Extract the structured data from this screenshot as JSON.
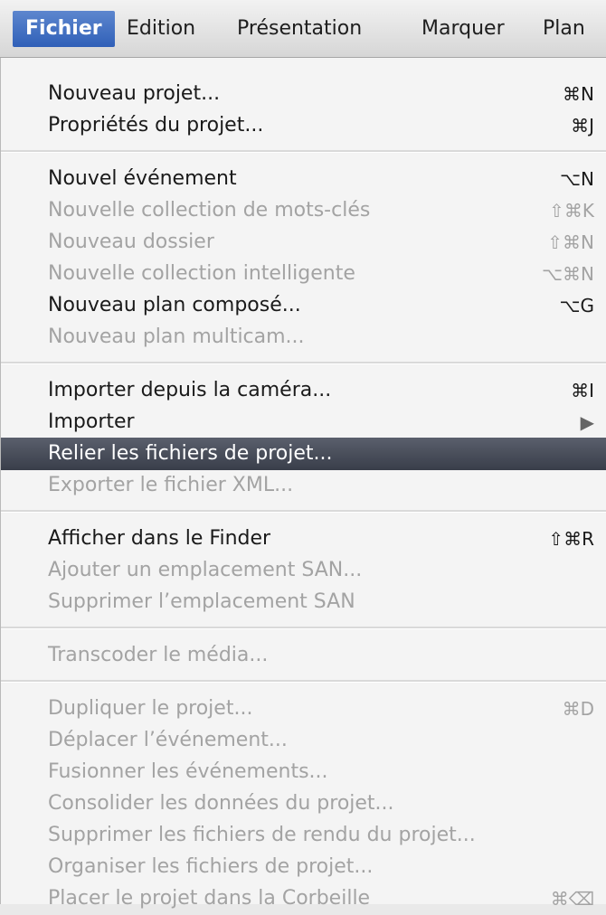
{
  "menubar": {
    "items": [
      "Fichier",
      "Edition",
      "Présentation",
      "Marquer",
      "Plan"
    ]
  },
  "menu": {
    "items": [
      {
        "label": "Nouveau projet...",
        "shortcut": "⌘N",
        "enabled": true
      },
      {
        "label": "Propriétés du projet...",
        "shortcut": "⌘J",
        "enabled": true
      },
      {
        "label": "Nouvel événement",
        "shortcut": "⌥N",
        "enabled": true
      },
      {
        "label": "Nouvelle collection de mots-clés",
        "shortcut": "⇧⌘K",
        "enabled": false
      },
      {
        "label": "Nouveau dossier",
        "shortcut": "⇧⌘N",
        "enabled": false
      },
      {
        "label": "Nouvelle collection intelligente",
        "shortcut": "⌥⌘N",
        "enabled": false
      },
      {
        "label": "Nouveau plan composé...",
        "shortcut": "⌥G",
        "enabled": true
      },
      {
        "label": "Nouveau plan multicam...",
        "shortcut": "",
        "enabled": false
      },
      {
        "label": "Importer depuis la caméra...",
        "shortcut": "⌘I",
        "enabled": true
      },
      {
        "label": "Importer",
        "shortcut": "▶",
        "enabled": true
      },
      {
        "label": "Relier les fichiers de projet...",
        "shortcut": "",
        "enabled": true
      },
      {
        "label": "Exporter le fichier XML...",
        "shortcut": "",
        "enabled": false
      },
      {
        "label": "Afficher dans le Finder",
        "shortcut": "⇧⌘R",
        "enabled": true
      },
      {
        "label": "Ajouter un emplacement SAN...",
        "shortcut": "",
        "enabled": false
      },
      {
        "label": "Supprimer l’emplacement SAN",
        "shortcut": "",
        "enabled": false
      },
      {
        "label": "Transcoder le média...",
        "shortcut": "",
        "enabled": false
      },
      {
        "label": "Dupliquer le projet...",
        "shortcut": "⌘D",
        "enabled": false
      },
      {
        "label": "Déplacer l’événement...",
        "shortcut": "",
        "enabled": false
      },
      {
        "label": "Fusionner les événements...",
        "shortcut": "",
        "enabled": false
      },
      {
        "label": "Consolider les données du projet...",
        "shortcut": "",
        "enabled": false
      },
      {
        "label": "Supprimer les fichiers de rendu du projet...",
        "shortcut": "",
        "enabled": false
      },
      {
        "label": "Organiser les fichiers de projet...",
        "shortcut": "",
        "enabled": false
      },
      {
        "label": "Placer le projet dans la Corbeille",
        "shortcut": "⌘⌫",
        "enabled": false
      }
    ]
  }
}
